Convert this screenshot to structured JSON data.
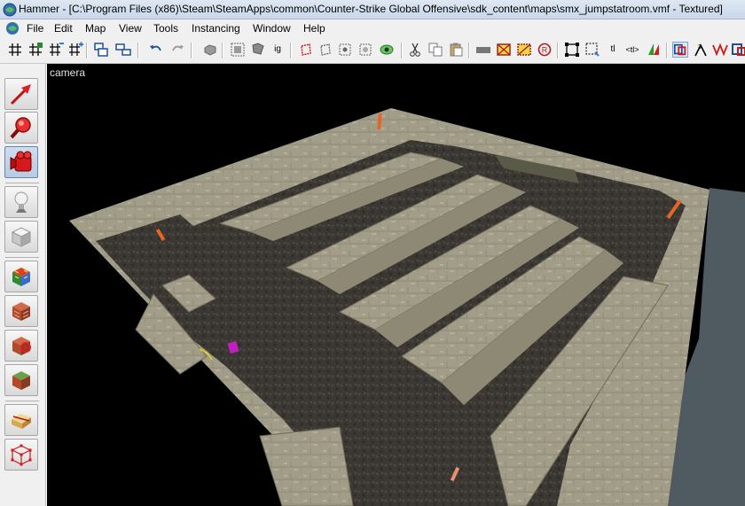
{
  "window": {
    "title": "Hammer - [C:\\Program Files (x86)\\Steam\\SteamApps\\common\\Counter-Strike Global Offensive\\sdk_content\\maps\\smx_jumpstatroom.vmf - Textured]"
  },
  "menu": {
    "items": [
      {
        "id": "file",
        "label": "File"
      },
      {
        "id": "edit",
        "label": "Edit"
      },
      {
        "id": "map",
        "label": "Map"
      },
      {
        "id": "view",
        "label": "View"
      },
      {
        "id": "tools",
        "label": "Tools"
      },
      {
        "id": "instancing",
        "label": "Instancing"
      },
      {
        "id": "window",
        "label": "Window"
      },
      {
        "id": "help",
        "label": "Help"
      }
    ]
  },
  "toolbar": {
    "text_buttons": {
      "ig": "ig",
      "tl": "tl",
      "tl_brackets": "<tl>"
    }
  },
  "palette": {
    "tools": [
      {
        "name": "selection-tool",
        "icon": "selection-arrow-icon"
      },
      {
        "name": "magnify-tool",
        "icon": "magnify-icon"
      },
      {
        "name": "camera-tool",
        "icon": "camera-icon",
        "active": true
      },
      {
        "name": "entity-tool",
        "icon": "entity-lightbulb-icon"
      },
      {
        "name": "block-tool",
        "icon": "block-cube-icon"
      },
      {
        "name": "texture-application-tool",
        "icon": "texture-application-icon"
      },
      {
        "name": "apply-current-texture-tool",
        "icon": "apply-texture-icon"
      },
      {
        "name": "decal-tool",
        "icon": "decal-icon"
      },
      {
        "name": "overlay-tool",
        "icon": "overlay-icon"
      },
      {
        "name": "clipping-tool",
        "icon": "clipping-icon"
      },
      {
        "name": "vertex-tool",
        "icon": "vertex-manipulation-icon"
      }
    ]
  },
  "viewport": {
    "label": "camera",
    "mode": "Textured"
  },
  "colors": {
    "viewport_bg": "#000000",
    "floor": "#3b3833",
    "stone": "#9e9a86",
    "entity_orange": "#e8652a",
    "entity_magenta": "#c020c0"
  }
}
